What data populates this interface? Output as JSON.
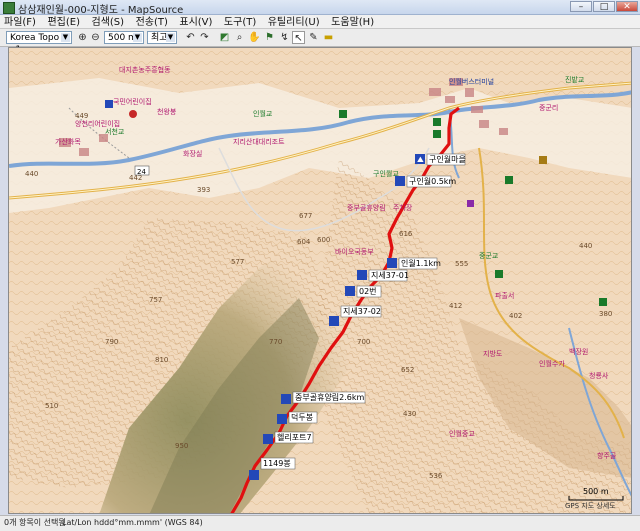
{
  "window": {
    "title": "삼삼재인월-000-지형도 - MapSource"
  },
  "menu": [
    "파일(F)",
    "편집(E)",
    "검색(S)",
    "전송(T)",
    "표시(V)",
    "도구(T)",
    "유틸리티(U)",
    "도움말(H)"
  ],
  "toolbar": {
    "map_product": "Korea Topo v1.",
    "scale_value": "500 m",
    "detail_value": "최고"
  },
  "track": {
    "color": "#e01010",
    "waypoints": [
      {
        "label": "구인월마을"
      },
      {
        "label": "구인월0.5km"
      },
      {
        "label": "인월1.1km"
      },
      {
        "label": "지세37-01"
      },
      {
        "label": "02번"
      },
      {
        "label": "지세37-02"
      },
      {
        "label": "중부골휴양림2.6km"
      },
      {
        "label": "덕두봉"
      },
      {
        "label": "헬리포트7"
      },
      {
        "label": "1149봉"
      }
    ]
  },
  "map": {
    "place_names": [
      {
        "text": "대지촌농주흥협동",
        "style": "place"
      },
      {
        "text": "인월버스터미널",
        "style": "place-blue"
      },
      {
        "text": "국민어린이집",
        "style": "place"
      },
      {
        "text": "양천리어린이집",
        "style": "place"
      },
      {
        "text": "인월교",
        "style": "place-green"
      },
      {
        "text": "서천교",
        "style": "place-green"
      },
      {
        "text": "가산화목",
        "style": "place"
      },
      {
        "text": "화장실",
        "style": "place"
      },
      {
        "text": "천왕봉",
        "style": "place"
      },
      {
        "text": "구인월교",
        "style": "place-green"
      },
      {
        "text": "지리산대대리조트",
        "style": "place"
      },
      {
        "text": "중부골휴양림",
        "style": "place"
      },
      {
        "text": "주차장",
        "style": "place"
      },
      {
        "text": "바이오국동부",
        "style": "place"
      },
      {
        "text": "파출서",
        "style": "place"
      },
      {
        "text": "중군교",
        "style": "place-green"
      },
      {
        "text": "지방도",
        "style": "place"
      },
      {
        "text": "백장원",
        "style": "place"
      },
      {
        "text": "인월수가",
        "style": "place"
      },
      {
        "text": "청룡사",
        "style": "place"
      },
      {
        "text": "진밭교",
        "style": "place-green"
      },
      {
        "text": "인월중교",
        "style": "place"
      },
      {
        "text": "향주골",
        "style": "place"
      },
      {
        "text": "중군리",
        "style": "place"
      }
    ],
    "elevations": [
      "449",
      "442",
      "440",
      "393",
      "577",
      "604",
      "600",
      "616",
      "555",
      "677",
      "757",
      "770",
      "790",
      "810",
      "700",
      "652",
      "950",
      "440",
      "412",
      "402",
      "380",
      "430",
      "510",
      "536",
      "1149"
    ],
    "road_numbers": [
      "24"
    ],
    "scale_bar": "500 m",
    "copyright": "GPS 지도 상세도"
  },
  "statusbar": {
    "selection": "0개 항목이 선택됨",
    "coord_format": "Lat/Lon hddd°mm.mmm' (WGS 84)"
  }
}
